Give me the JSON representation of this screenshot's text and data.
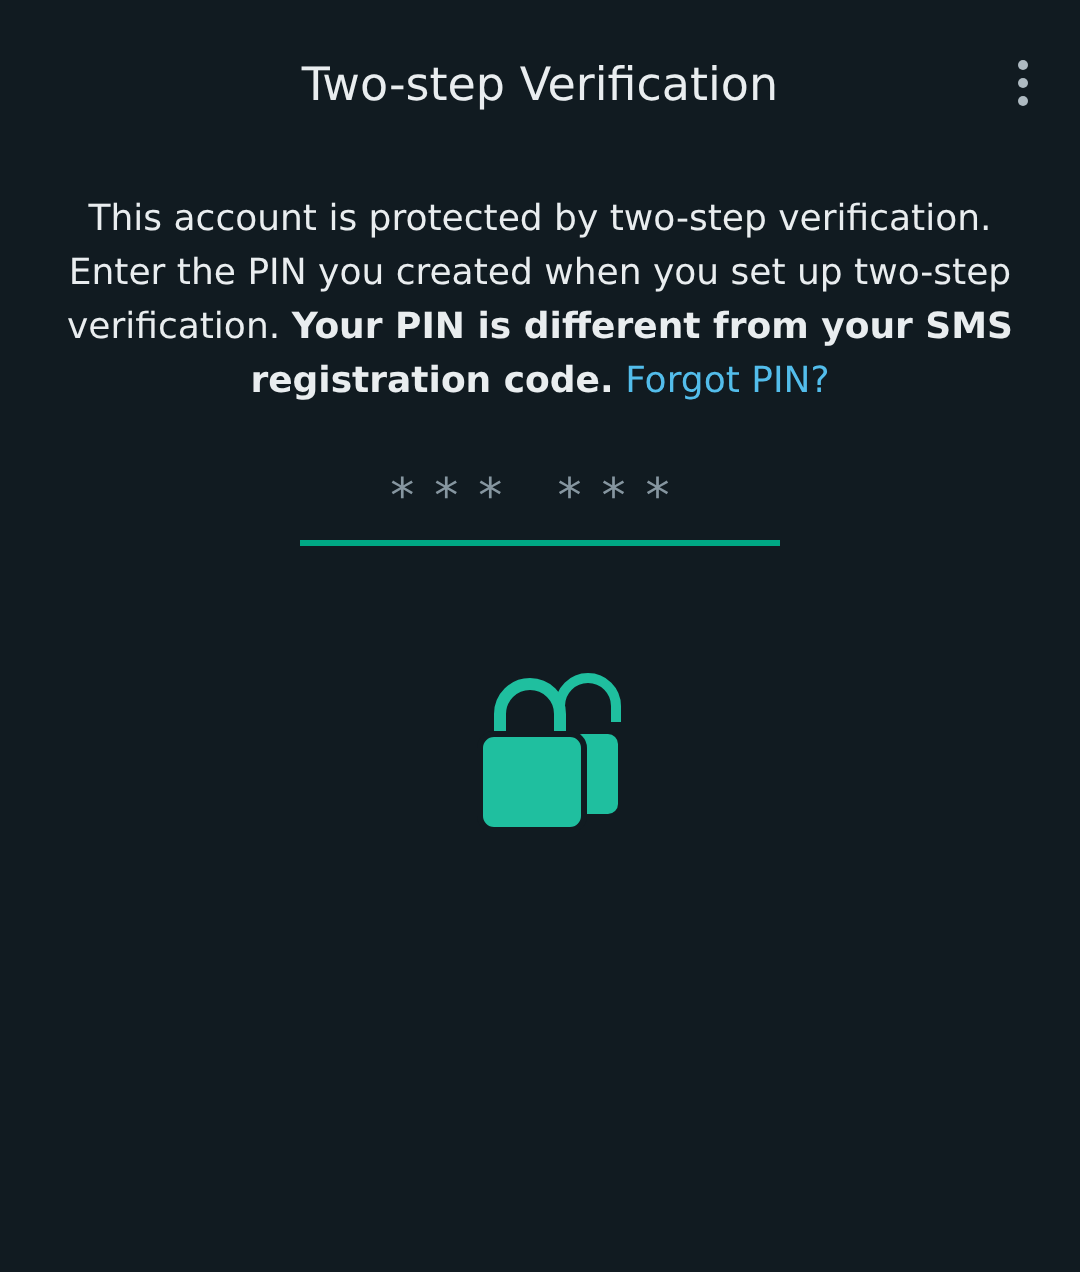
{
  "header": {
    "title": "Two-step Verification"
  },
  "message": {
    "text": "This account is protected by two-step verification. Enter the PIN you created when you set up two-step verification. **Your PIN is different from your SMS registration code.**",
    "link": "Forgot PIN?"
  },
  "pin_field": {
    "placeholder": "*** ***"
  }
}
